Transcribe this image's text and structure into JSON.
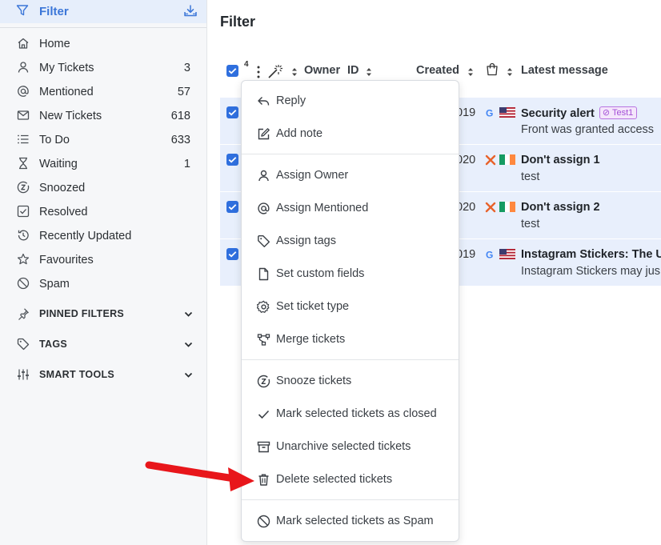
{
  "sidebar": {
    "header": {
      "title": "Filter",
      "icon": "filter-icon",
      "action_icon": "download-icon"
    },
    "items": [
      {
        "label": "Home",
        "count": "",
        "icon": "home-icon"
      },
      {
        "label": "My Tickets",
        "count": "3",
        "icon": "user-icon"
      },
      {
        "label": "Mentioned",
        "count": "57",
        "icon": "at-icon"
      },
      {
        "label": "New Tickets",
        "count": "618",
        "icon": "envelope-icon"
      },
      {
        "label": "To Do",
        "count": "633",
        "icon": "list-icon"
      },
      {
        "label": "Waiting",
        "count": "1",
        "icon": "hourglass-icon"
      },
      {
        "label": "Snoozed",
        "count": "",
        "icon": "snooze-icon"
      },
      {
        "label": "Resolved",
        "count": "",
        "icon": "checkbox-icon"
      },
      {
        "label": "Recently Updated",
        "count": "",
        "icon": "history-icon"
      },
      {
        "label": "Favourites",
        "count": "",
        "icon": "star-icon"
      },
      {
        "label": "Spam",
        "count": "",
        "icon": "ban-icon"
      }
    ],
    "sections": [
      {
        "label": "PINNED FILTERS",
        "icon": "pin-icon"
      },
      {
        "label": "TAGS",
        "icon": "tag-icon"
      },
      {
        "label": "SMART TOOLS",
        "icon": "sliders-icon"
      }
    ]
  },
  "main": {
    "title": "Filter",
    "selected_count": "4",
    "columns": {
      "owner": "Owner",
      "id": "ID",
      "created": "Created",
      "latest": "Latest message"
    },
    "rows": [
      {
        "date": "019",
        "source": "google",
        "flag": "us",
        "subject": "Security alert",
        "tag": "Test1",
        "preview": "Front was granted access"
      },
      {
        "date": "020",
        "source": "x",
        "flag": "ie",
        "subject": "Don't assign 1",
        "tag": "",
        "preview": "test"
      },
      {
        "date": "020",
        "source": "x",
        "flag": "ie",
        "subject": "Don't assign 2",
        "tag": "",
        "preview": "test"
      },
      {
        "date": "019",
        "source": "google",
        "flag": "us",
        "subject": "Instagram Stickers: The U",
        "tag": "",
        "preview": "Instagram Stickers may jus"
      }
    ]
  },
  "menu": {
    "items": [
      {
        "label": "Reply",
        "icon": "reply-icon"
      },
      {
        "label": "Add note",
        "icon": "edit-icon"
      },
      {
        "label": "Assign Owner",
        "icon": "user-icon"
      },
      {
        "label": "Assign Mentioned",
        "icon": "at-icon"
      },
      {
        "label": "Assign tags",
        "icon": "tag-icon"
      },
      {
        "label": "Set custom fields",
        "icon": "document-icon"
      },
      {
        "label": "Set ticket type",
        "icon": "gear-icon"
      },
      {
        "label": "Merge tickets",
        "icon": "merge-icon"
      },
      {
        "label": "Snooze tickets",
        "icon": "snooze-icon"
      },
      {
        "label": "Mark selected tickets as closed",
        "icon": "check-icon"
      },
      {
        "label": "Unarchive selected tickets",
        "icon": "archive-icon"
      },
      {
        "label": "Delete selected tickets",
        "icon": "trash-icon"
      },
      {
        "label": "Mark selected tickets as Spam",
        "icon": "ban-icon"
      }
    ]
  },
  "colors": {
    "accent": "#3b76d8",
    "selected_row": "#e8effc",
    "sidebar_bg": "#f6f7f9",
    "arrow": "#e8161b",
    "tag": "#a44fd6"
  }
}
